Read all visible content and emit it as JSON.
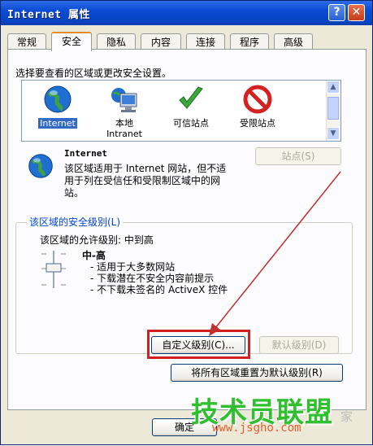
{
  "window": {
    "title": "Internet 属性",
    "help_label": "?",
    "close_label": "✕"
  },
  "tabs": [
    {
      "label": "常规"
    },
    {
      "label": "安全"
    },
    {
      "label": "隐私"
    },
    {
      "label": "内容"
    },
    {
      "label": "连接"
    },
    {
      "label": "程序"
    },
    {
      "label": "高级"
    }
  ],
  "active_tab": "安全",
  "security": {
    "prompt": "选择要查看的区域或更改安全设置。",
    "zones": [
      {
        "label": "Internet",
        "icon": "globe-icon",
        "selected": true
      },
      {
        "label": "本地\nIntranet",
        "icon": "intranet-icon",
        "selected": false
      },
      {
        "label": "可信站点",
        "icon": "checkmark-icon",
        "selected": false
      },
      {
        "label": "受限站点",
        "icon": "prohibited-icon",
        "selected": false
      }
    ],
    "zone_title": "Internet",
    "zone_desc": "该区域适用于 Internet 网站，但不适用于列在受信任和受限制区域中的网站。",
    "sites_button": "站点(S)",
    "group_label": "该区域的安全级别(L)",
    "allowed_levels": "该区域的允许级别: 中到高",
    "level_name": "中-高",
    "level_items": [
      "- 适用于大多数网站",
      "- 下载潜在不安全内容前提示",
      "- 不下载未签名的 ActiveX 控件"
    ],
    "custom_level_button": "自定义级别(C)...",
    "default_level_button": "默认级别(D)",
    "reset_all_button": "将所有区域重置为默认级别(R)"
  },
  "footer": {
    "ok_button": "确定"
  },
  "watermark": {
    "text": "技术员联盟",
    "url": "www.jsgho.com",
    "side": "家"
  },
  "colors": {
    "title_bar": "#0a4bd5",
    "highlight_box": "#d02020",
    "arrow": "#c03030",
    "active_tab_border": "#e68b2c",
    "watermark": "#2fbf2f"
  }
}
